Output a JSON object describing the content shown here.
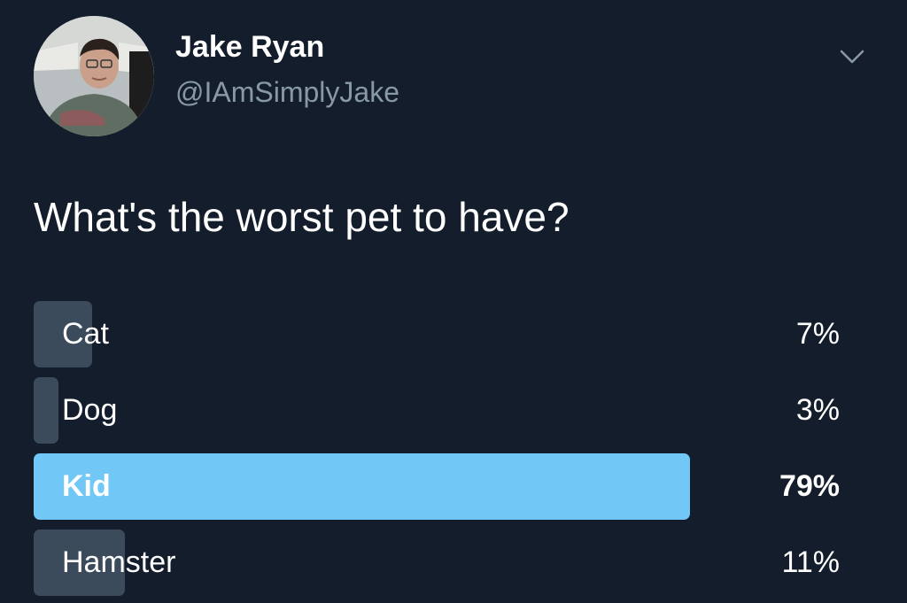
{
  "tweet": {
    "display_name": "Jake Ryan",
    "handle": "@IAmSimplyJake",
    "question": "What's the worst pet to have?"
  },
  "poll": {
    "options": [
      {
        "label": "Cat",
        "percent_text": "7%",
        "percent": 7,
        "winner": false
      },
      {
        "label": "Dog",
        "percent_text": "3%",
        "percent": 3,
        "winner": false
      },
      {
        "label": "Kid",
        "percent_text": "79%",
        "percent": 79,
        "winner": true
      },
      {
        "label": "Hamster",
        "percent_text": "11%",
        "percent": 11,
        "winner": false
      }
    ]
  },
  "icons": {
    "menu": "chevron-down-icon"
  },
  "colors": {
    "background": "#141d2b",
    "bar": "#3b4b5c",
    "winner_bar": "#71c8f7",
    "handle_text": "#8899a6"
  }
}
